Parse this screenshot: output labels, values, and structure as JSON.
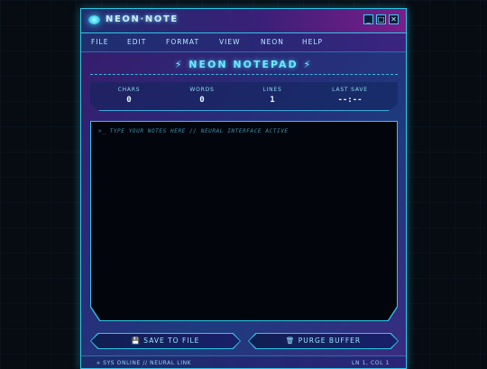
{
  "window": {
    "title": "NEON·NOTE",
    "controls": {
      "minimize": "_",
      "maximize": "□",
      "close": "✕"
    }
  },
  "menu": [
    "FILE",
    "EDIT",
    "FORMAT",
    "VIEW",
    "NEON",
    "HELP"
  ],
  "heading": {
    "bolt": "⚡",
    "text": "NEON NOTEPAD"
  },
  "stats": [
    {
      "label": "CHARS",
      "value": "0"
    },
    {
      "label": "WORDS",
      "value": "0"
    },
    {
      "label": "LINES",
      "value": "1"
    },
    {
      "label": "LAST SAVE",
      "value": "--:--"
    }
  ],
  "editor": {
    "value": "",
    "placeholder": ">_ TYPE YOUR NOTES HERE // NEURAL INTERFACE ACTIVE"
  },
  "buttons": {
    "save": {
      "icon": "💾",
      "label": "SAVE TO FILE"
    },
    "purge": {
      "icon": "🗑",
      "label": "PURGE BUFFER"
    }
  },
  "status": {
    "left": "⟡ SYS ONLINE // NEURAL LINK",
    "right": "LN 1, COL 1"
  },
  "icons": {
    "logo": "neon-orb-icon",
    "save": "floppy-disk-icon",
    "purge": "trash-icon"
  },
  "colors": {
    "accent": "#2fc6e6",
    "editor_bg": "#03050d",
    "heading": "#6fe9ff"
  }
}
